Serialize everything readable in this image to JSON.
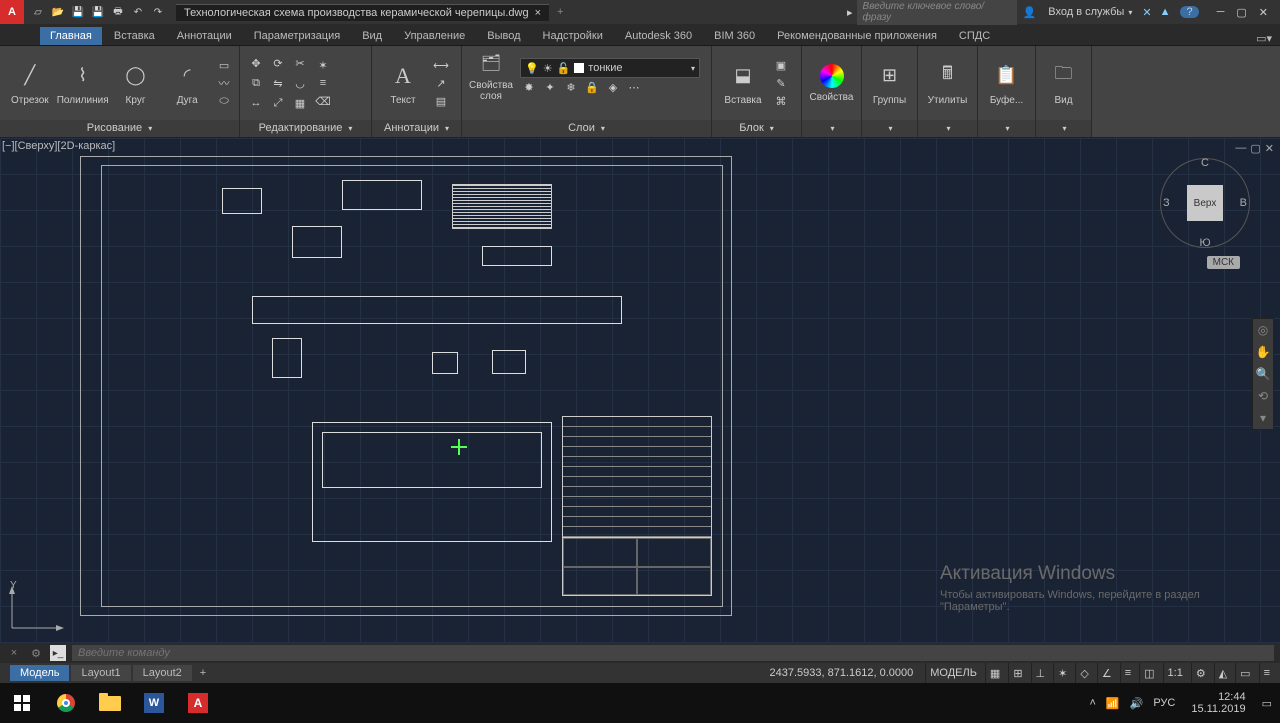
{
  "title": "Технологическая схема производства керамической черепицы.dwg",
  "search_placeholder": "Введите ключевое слово/фразу",
  "signin": "Вход в службы",
  "ribbon_tabs": [
    "Главная",
    "Вставка",
    "Аннотации",
    "Параметризация",
    "Вид",
    "Управление",
    "Вывод",
    "Надстройки",
    "Autodesk 360",
    "BIM 360",
    "Рекомендованные приложения",
    "СПДС"
  ],
  "panels": {
    "draw": {
      "title": "Рисование",
      "items": [
        "Отрезок",
        "Полилиния",
        "Круг",
        "Дуга"
      ]
    },
    "modify": {
      "title": "Редактирование"
    },
    "annot": {
      "title": "Аннотации",
      "text": "Текст"
    },
    "layers": {
      "title": "Слои",
      "prop": "Свойства\nслоя",
      "layer_sel": "тонкие"
    },
    "block": {
      "title": "Блок",
      "insert": "Вставка"
    },
    "props": {
      "title": "Свойства"
    },
    "groups": {
      "title": "Группы"
    },
    "utils": {
      "title": "Утилиты"
    },
    "clip": {
      "title": "Буфе..."
    },
    "view": {
      "title": "Вид"
    }
  },
  "viewport_label": "[−][Сверху][2D-каркас]",
  "navcube": {
    "top": "Верх",
    "n": "С",
    "s": "Ю",
    "w": "З",
    "e": "В"
  },
  "wcs": "МСК",
  "ucs_y": "Y",
  "watermark": {
    "title": "Активация Windows",
    "sub": "Чтобы активировать Windows, перейдите в раздел \"Параметры\"."
  },
  "cmd_placeholder": "Введите команду",
  "model_tabs": [
    "Модель",
    "Layout1",
    "Layout2"
  ],
  "status": {
    "coords": "2437.5933, 871.1612, 0.0000",
    "model": "МОДЕЛЬ",
    "scale": "1:1"
  },
  "tray": {
    "lang": "РУС",
    "time": "12:44",
    "date": "15.11.2019"
  }
}
